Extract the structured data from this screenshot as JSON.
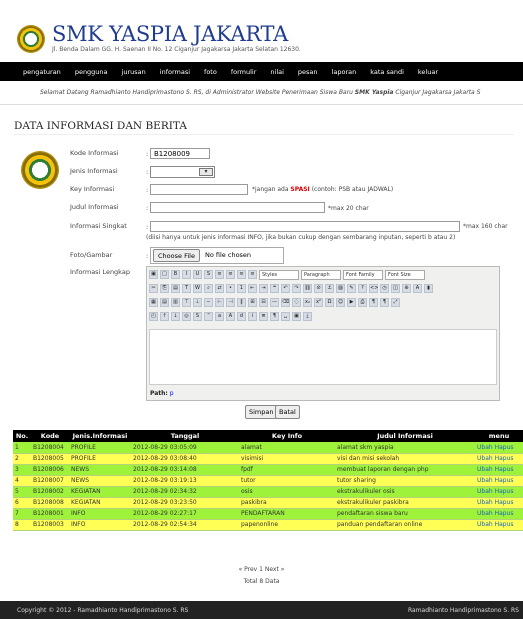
{
  "header": {
    "title": "SMK YASPIA JAKARTA",
    "address": "Jl. Benda Dalam GG. H. Saenan II No. 12 Ciganjur Jagakarsa Jakarta Selatan 12630."
  },
  "nav": [
    "pengaturan",
    "pengguna",
    "jurusan",
    "informasi",
    "foto",
    "formulir",
    "nilai",
    "pesan",
    "laporan",
    "kata sandi",
    "keluar"
  ],
  "marquee": {
    "text": "Selamat Datang Ramadhianto Handiprimastono S. RS, di Administrator Website Penerimaan Siswa Baru ",
    "bold": "SMK Yaspia",
    "tail": " Ciganjur Jagakarsa Jakarta S"
  },
  "page_title": "DATA INFORMASI DAN BERITA",
  "form": {
    "kode_label": "Kode Informasi",
    "kode_value": "B1208009",
    "jenis_label": "Jenis Informasi",
    "key_label": "Key Informasi",
    "key_hint_pre": "*jangan ada ",
    "key_hint_red": "SPASI",
    "key_hint_post": " (contoh: PSB atau JADWAL)",
    "judul_label": "Judul Informasi",
    "judul_hint": "*max 20 char",
    "singkat_label": "Informasi Singkat",
    "singkat_hint": "*max 160 char",
    "singkat_note": "(diisi hanya untuk jenis informasi INFO, jika bukan cukup dengan sembarang inputan, seperti b atau 2)",
    "foto_label": "Foto/Gambar",
    "file_button": "Choose File",
    "file_status": "No file chosen",
    "lengkap_label": "Informasi Lengkap",
    "editor": {
      "style_select": "Styles",
      "paragraph_select": "Paragraph",
      "font_family_select": "Font Family",
      "font_size_select": "Font Size",
      "path_label": "Path:",
      "path_value": "p"
    },
    "save_button": "Simpan",
    "cancel_button": "Batal"
  },
  "table": {
    "headers": [
      "No.",
      "Kode",
      "Jenis.Informasi",
      "Tanggal",
      "Key Info",
      "Judul Informasi",
      "menu"
    ],
    "rows": [
      [
        "1",
        "B1208004",
        "PROFILE",
        "2012-08-29 03:05:09",
        "alamat",
        "alamat skm yaspia",
        "Ubah Hapus"
      ],
      [
        "2",
        "B1208005",
        "PROFILE",
        "2012-08-29 03:08:40",
        "visimisi",
        "visi dan misi sekolah",
        "Ubah Hapus"
      ],
      [
        "3",
        "B1208006",
        "NEWS",
        "2012-08-29 03:14:08",
        "fpdf",
        "membuat laporan dengan php",
        "Ubah Hapus"
      ],
      [
        "4",
        "B1208007",
        "NEWS",
        "2012-08-29 03:19:13",
        "tutor",
        "tutor sharing",
        "Ubah Hapus"
      ],
      [
        "5",
        "B1208002",
        "KEGIATAN",
        "2012-08-29 02:34:32",
        "osis",
        "ekstrakulikuler osis",
        "Ubah Hapus"
      ],
      [
        "6",
        "B1208008",
        "KEGIATAN",
        "2012-08-29 03:23:50",
        "paskibra",
        "ekstrakulikuler paskibra",
        "Ubah Hapus"
      ],
      [
        "7",
        "B1208001",
        "INFO",
        "2012-08-29 02:27:17",
        "PENDAFTARAN",
        "pendaftaran siswa baru",
        "Ubah Hapus"
      ],
      [
        "8",
        "B1208003",
        "INFO",
        "2012-08-29 02:54:34",
        "papenonline",
        "panduan pendaftaran online",
        "Ubah Hapus"
      ]
    ]
  },
  "pager": "« Prev 1 Next »",
  "total": "Total 8 Data",
  "footer": {
    "left": "Copyright © 2012 - Ramadhianto Handiprimastono S. RS",
    "right": "Ramadhianto Handiprimastono S. RS"
  },
  "colors": {
    "navbar": "#000000",
    "row_green": "#9ef23a",
    "row_yellow": "#ffff55",
    "title_blue": "#1f3c8f"
  }
}
